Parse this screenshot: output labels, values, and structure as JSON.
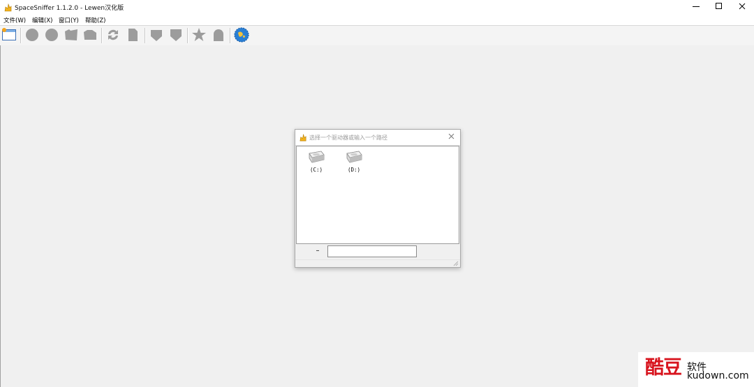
{
  "window": {
    "title": "SpaceSniffer 1.1.2.0 - Lewen汉化版",
    "icon": "spacesniffer-app-icon",
    "controls": [
      "minimize-icon",
      "maximize-icon",
      "close-icon"
    ]
  },
  "menu": {
    "items": [
      {
        "label": "文件(W)"
      },
      {
        "label": "编辑(X)"
      },
      {
        "label": "窗口(Y)"
      },
      {
        "label": "帮助(Z)"
      }
    ]
  },
  "toolbar": {
    "buttons": [
      {
        "icon": "new-scan-window-icon"
      },
      {
        "icon": "circle-icon"
      },
      {
        "icon": "circle-icon"
      },
      {
        "icon": "folder-icon"
      },
      {
        "icon": "folder-icon"
      },
      {
        "icon": "refresh-icon"
      },
      {
        "icon": "document-icon"
      },
      {
        "icon": "shield-icon"
      },
      {
        "icon": "shield-icon"
      },
      {
        "icon": "star-icon"
      },
      {
        "icon": "ghost-icon"
      },
      {
        "icon": "globe-icon"
      }
    ]
  },
  "dialog": {
    "title": "选择一个驱动器或输入一个路径",
    "drives": [
      {
        "label": "(C:)",
        "icon": "hard-drive-icon"
      },
      {
        "label": "(D:)",
        "icon": "hard-drive-icon"
      }
    ],
    "path_button_label": "–",
    "path_input_value": "",
    "path_input_placeholder": ""
  },
  "watermark": {
    "logo_text": "酷豆",
    "cn_text": "软件",
    "url_text": "kudown.com",
    "color": "#d8141e"
  },
  "colors": {
    "workspace_bg": "#f0f0f0",
    "toolbar_icon": "#9c9c9c",
    "globe_blue": "#2a7fd4"
  }
}
